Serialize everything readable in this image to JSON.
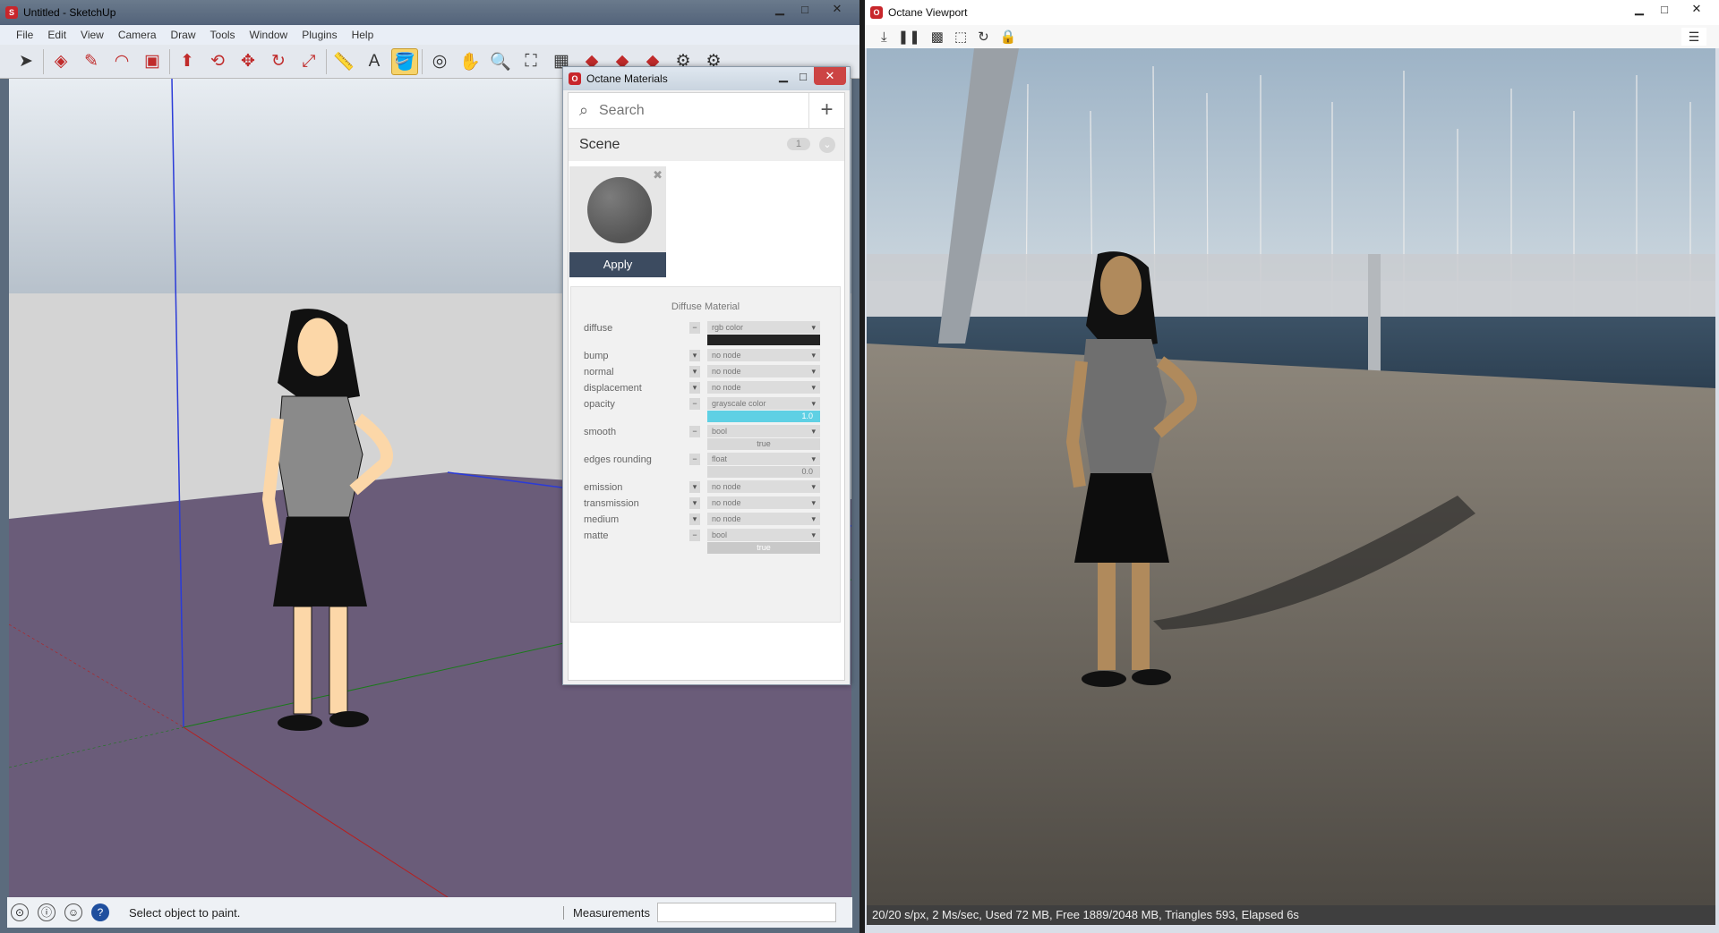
{
  "sketchup": {
    "title": "Untitled - SketchUp",
    "menu": [
      "File",
      "Edit",
      "View",
      "Camera",
      "Draw",
      "Tools",
      "Window",
      "Plugins",
      "Help"
    ],
    "status_text": "Select object to paint.",
    "measurements_label": "Measurements",
    "measurements_value": ""
  },
  "materials": {
    "title": "Octane Materials",
    "search_placeholder": "Search",
    "scene_label": "Scene",
    "scene_count": "1",
    "apply_label": "Apply",
    "panel_title": "Diffuse Material",
    "params": [
      {
        "label": "diffuse",
        "node": "rgb color",
        "value": ""
      },
      {
        "label": "bump",
        "node": "no node"
      },
      {
        "label": "normal",
        "node": "no node"
      },
      {
        "label": "displacement",
        "node": "no node"
      },
      {
        "label": "opacity",
        "node": "grayscale color",
        "value": "1.0"
      },
      {
        "label": "smooth",
        "node": "bool",
        "value": "true"
      },
      {
        "label": "edges rounding",
        "node": "float",
        "value": "0.0"
      },
      {
        "label": "emission",
        "node": "no node"
      },
      {
        "label": "transmission",
        "node": "no node"
      },
      {
        "label": "medium",
        "node": "no node"
      },
      {
        "label": "matte",
        "node": "bool",
        "value": "true"
      }
    ]
  },
  "viewport": {
    "title": "Octane Viewport",
    "status": "20/20 s/px, 2 Ms/sec, Used 72 MB, Free 1889/2048 MB, Triangles 593, Elapsed 6s"
  },
  "icons": {
    "window_minimize": "minimize-icon",
    "window_maximize": "maximize-icon",
    "window_close": "close-icon"
  }
}
